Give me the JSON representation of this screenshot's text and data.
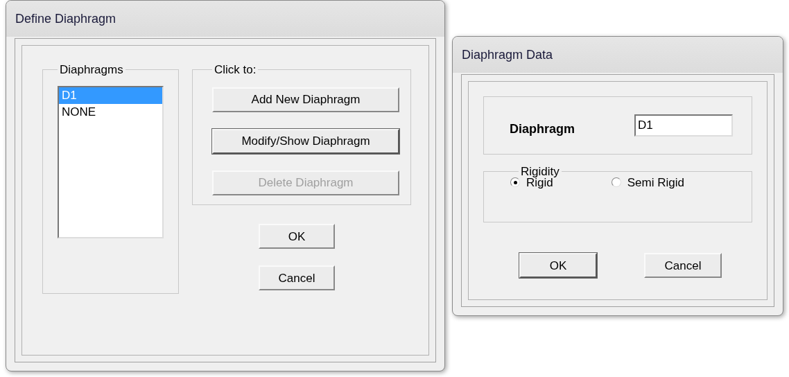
{
  "define_window": {
    "title": "Define Diaphragm",
    "diaphragms_group": {
      "label": "Diaphragms",
      "items": [
        {
          "label": "D1",
          "selected": true
        },
        {
          "label": "NONE",
          "selected": false
        }
      ]
    },
    "actions_group": {
      "label": "Click to:",
      "buttons": [
        {
          "label": "Add New Diaphragm",
          "disabled": false,
          "default": false
        },
        {
          "label": "Modify/Show Diaphragm",
          "disabled": false,
          "default": true
        },
        {
          "label": "Delete Diaphragm",
          "disabled": true,
          "default": false
        }
      ]
    },
    "buttons": [
      {
        "label": "OK",
        "default": false
      },
      {
        "label": "Cancel",
        "default": false
      }
    ]
  },
  "data_window": {
    "title": "Diaphragm Data",
    "name_label": "Diaphragm",
    "name_value": "D1",
    "rigidity": {
      "label": "Rigidity",
      "options": [
        {
          "label": "Rigid",
          "selected": true
        },
        {
          "label": "Semi Rigid",
          "selected": false
        }
      ]
    },
    "buttons": [
      {
        "label": "OK",
        "default": true
      },
      {
        "label": "Cancel",
        "default": false
      }
    ]
  }
}
